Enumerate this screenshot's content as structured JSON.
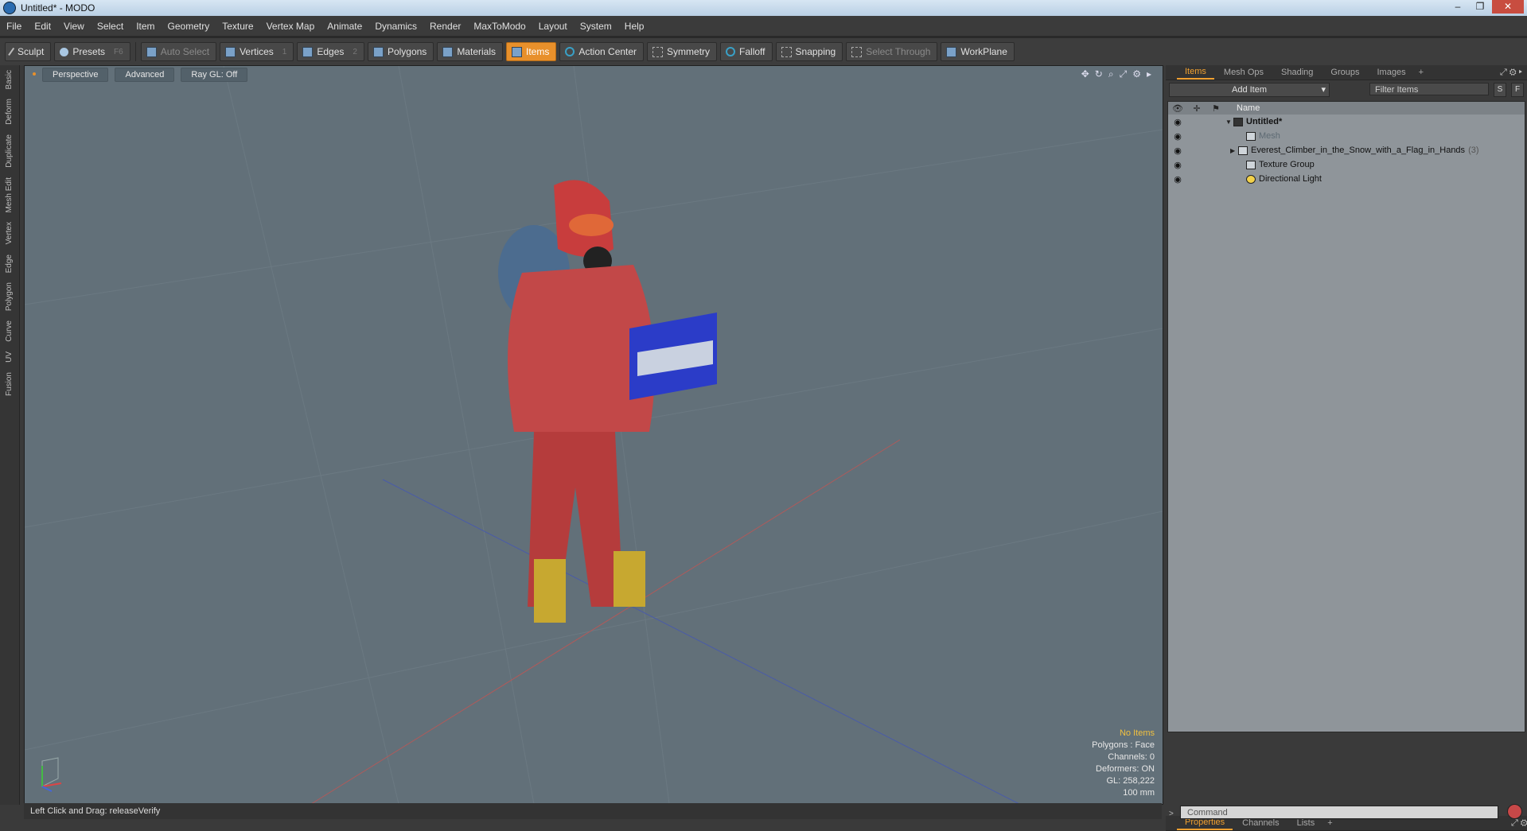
{
  "window": {
    "title": "Untitled* - MODO",
    "controls": [
      "–",
      "❐",
      "✕"
    ]
  },
  "menu": [
    "File",
    "Edit",
    "View",
    "Select",
    "Item",
    "Geometry",
    "Texture",
    "Vertex Map",
    "Animate",
    "Dynamics",
    "Render",
    "MaxToModo",
    "Layout",
    "System",
    "Help"
  ],
  "toolbar": {
    "sculpt": "Sculpt",
    "presets": "Presets",
    "presets_key": "F6",
    "auto_select": "Auto Select",
    "vertices": "Vertices",
    "vertices_key": "1",
    "edges": "Edges",
    "edges_key": "2",
    "polygons": "Polygons",
    "materials": "Materials",
    "items": "Items",
    "action_center": "Action Center",
    "symmetry": "Symmetry",
    "falloff": "Falloff",
    "snapping": "Snapping",
    "select_through": "Select Through",
    "workplane": "WorkPlane"
  },
  "left_tabs": [
    "Basic",
    "Deform",
    "Duplicate",
    "Mesh Edit",
    "Vertex",
    "Edge",
    "Polygon",
    "Curve",
    "UV",
    "Fusion"
  ],
  "viewport": {
    "view": "Perspective",
    "shading": "Advanced",
    "raygl": "Ray GL: Off",
    "stats": {
      "items": "No Items",
      "polygons": "Polygons : Face",
      "channels": "Channels: 0",
      "deformers": "Deformers: ON",
      "gl": "GL: 258,222",
      "scale": "100 mm"
    }
  },
  "status": {
    "hint": "Left Click and Drag:   releaseVerify"
  },
  "right_panel": {
    "tabs": [
      "Items",
      "Mesh Ops",
      "Shading",
      "Groups",
      "Images"
    ],
    "add_item": "Add Item",
    "filter_placeholder": "Filter Items",
    "s_btn": "S",
    "f_btn": "F",
    "name_col": "Name",
    "tree": [
      {
        "label": "Untitled*",
        "count": ""
      },
      {
        "label": "Mesh",
        "count": ""
      },
      {
        "label": "Everest_Climber_in_the_Snow_with_a_Flag_in_Hands",
        "count": "(3)"
      },
      {
        "label": "Texture Group",
        "count": ""
      },
      {
        "label": "Directional Light",
        "count": ""
      }
    ],
    "bottom_tabs": [
      "Properties",
      "Channels",
      "Lists"
    ],
    "command_placeholder": "Command"
  },
  "colors": {
    "accent": "#e8902b",
    "viewport_bg": "#627079"
  }
}
